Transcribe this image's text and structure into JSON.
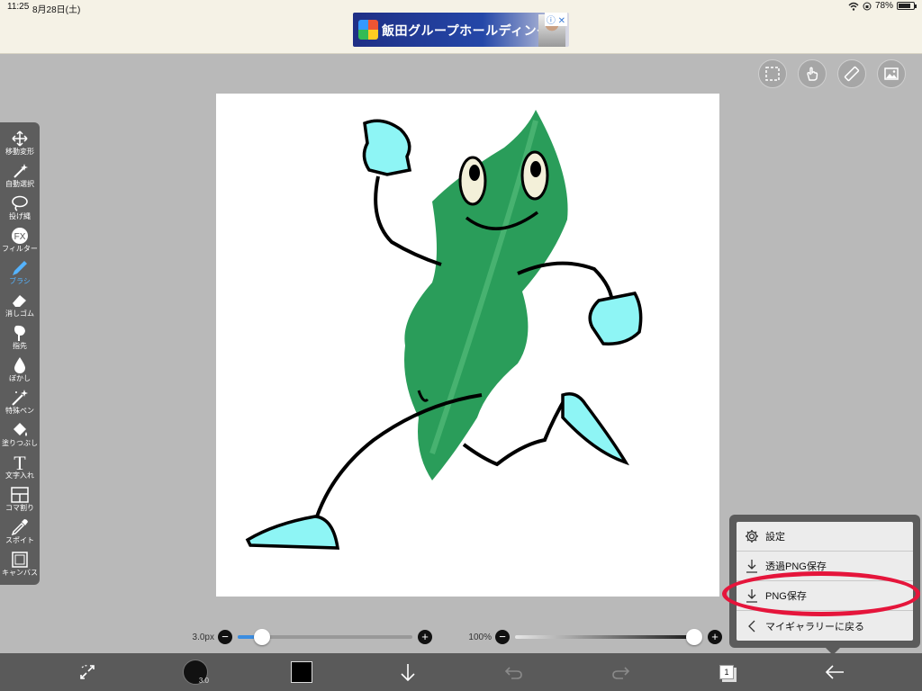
{
  "status_bar": {
    "time": "11:25",
    "date": "8月28日(土)",
    "battery": "78%"
  },
  "ad": {
    "text": "飯田グループホールディングス",
    "close": "ⓘ ✕"
  },
  "top_tools": [
    "selection-icon",
    "hand-icon",
    "ruler-icon",
    "image-icon"
  ],
  "toolbar": {
    "tools": [
      {
        "label": "移動変形",
        "icon": "move-icon"
      },
      {
        "label": "自動選択",
        "icon": "magic-wand-icon"
      },
      {
        "label": "投げ縄",
        "icon": "lasso-icon"
      },
      {
        "label": "フィルター",
        "icon": "fx-icon"
      },
      {
        "label": "ブラシ",
        "icon": "brush-icon",
        "active": true
      },
      {
        "label": "消しゴム",
        "icon": "eraser-icon"
      },
      {
        "label": "指先",
        "icon": "finger-icon"
      },
      {
        "label": "ぼかし",
        "icon": "blur-icon"
      },
      {
        "label": "特殊ペン",
        "icon": "special-pen-icon"
      },
      {
        "label": "塗りつぶし",
        "icon": "fill-icon"
      },
      {
        "label": "文字入れ",
        "icon": "text-icon"
      },
      {
        "label": "コマ割り",
        "icon": "frame-icon"
      },
      {
        "label": "スポイト",
        "icon": "eyedropper-icon"
      },
      {
        "label": "キャンバス",
        "icon": "canvas-icon"
      }
    ]
  },
  "sliders": {
    "size_label": "3.0px",
    "size_fraction": 0.1,
    "opacity_label": "100%",
    "opacity_fraction": 1.0,
    "plus": "+",
    "minus": "−"
  },
  "bottom_bar": {
    "brush_size": "3.0",
    "layer_count": "1",
    "color": "#000000"
  },
  "menu": {
    "items": [
      {
        "label": "設定",
        "icon": "gear-icon"
      },
      {
        "label": "透過PNG保存",
        "icon": "download-icon"
      },
      {
        "label": "PNG保存",
        "icon": "download-icon"
      },
      {
        "label": "マイギャラリーに戻る",
        "icon": "chevron-left-icon"
      }
    ]
  },
  "colors": {
    "accent": "#3b8de0",
    "highlight": "#e5153b",
    "leaf_green": "#2a9d5a",
    "glove_cyan": "#8ef5f5"
  }
}
